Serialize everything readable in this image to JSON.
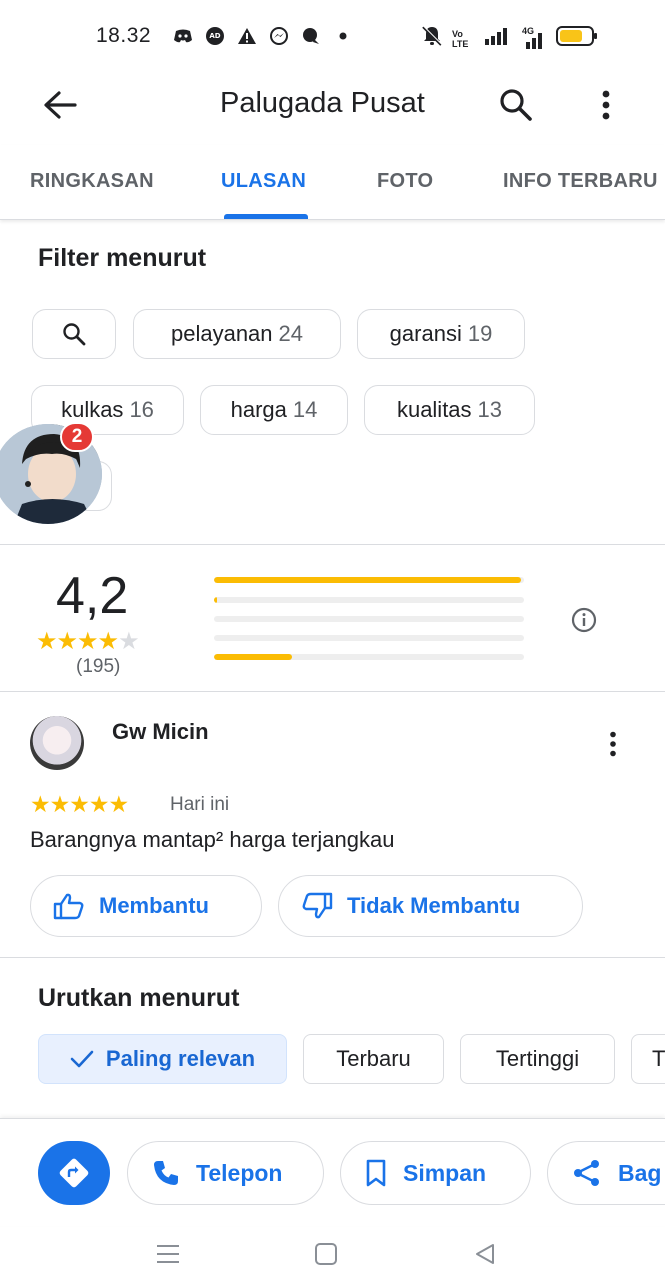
{
  "status_bar": {
    "time": "18.32",
    "left_icons": [
      "discord-icon",
      "ad-icon",
      "warning-icon",
      "messenger-icon",
      "chat-bubble-icon",
      "dot-icon"
    ],
    "right_icons": [
      "mute-icon",
      "volte-icon",
      "signal-icon",
      "4g-signal-icon",
      "battery-icon"
    ],
    "signal_label": "Vo LTE",
    "network_label": "4G"
  },
  "header": {
    "title": "Palugada Pusat",
    "back_icon": "arrow-left-icon",
    "search_icon": "search-icon",
    "more_icon": "more-vert-icon"
  },
  "tabs": [
    {
      "label": "RINGKASAN",
      "active": false
    },
    {
      "label": "ULASAN",
      "active": true
    },
    {
      "label": "FOTO",
      "active": false
    },
    {
      "label": "INFO TERBARU",
      "active": false
    }
  ],
  "filter": {
    "title": "Filter menurut",
    "chips": [
      {
        "label": "pelayanan",
        "count": "24"
      },
      {
        "label": "garansi",
        "count": "19"
      },
      {
        "label": "kulkas",
        "count": "16"
      },
      {
        "label": "harga",
        "count": "14"
      },
      {
        "label": "kualitas",
        "count": "13"
      }
    ]
  },
  "floating_bubble": {
    "badge": "2"
  },
  "rating_summary": {
    "value": "4,2",
    "stars_filled": 4,
    "count": "(195)",
    "distribution": [
      0.99,
      0.01,
      0.0,
      0.0,
      0.25
    ],
    "accent_color": "#fbbc04"
  },
  "review": {
    "author": "Gw Micin",
    "stars": 5,
    "time": "Hari ini",
    "text": "Barangnya mantap² harga terjangkau",
    "helpful_label": "Membantu",
    "not_helpful_label": "Tidak Membantu"
  },
  "sort": {
    "title": "Urutkan menurut",
    "options": [
      {
        "label": "Paling relevan",
        "selected": true
      },
      {
        "label": "Terbaru",
        "selected": false
      },
      {
        "label": "Tertinggi",
        "selected": false
      },
      {
        "label": "T",
        "selected": false
      }
    ]
  },
  "actions": {
    "directions_icon": "directions-icon",
    "call_label": "Telepon",
    "save_label": "Simpan",
    "share_label": "Bag"
  },
  "colors": {
    "accent": "#1a73e8",
    "star": "#fbbc04",
    "badge": "#e53935"
  }
}
